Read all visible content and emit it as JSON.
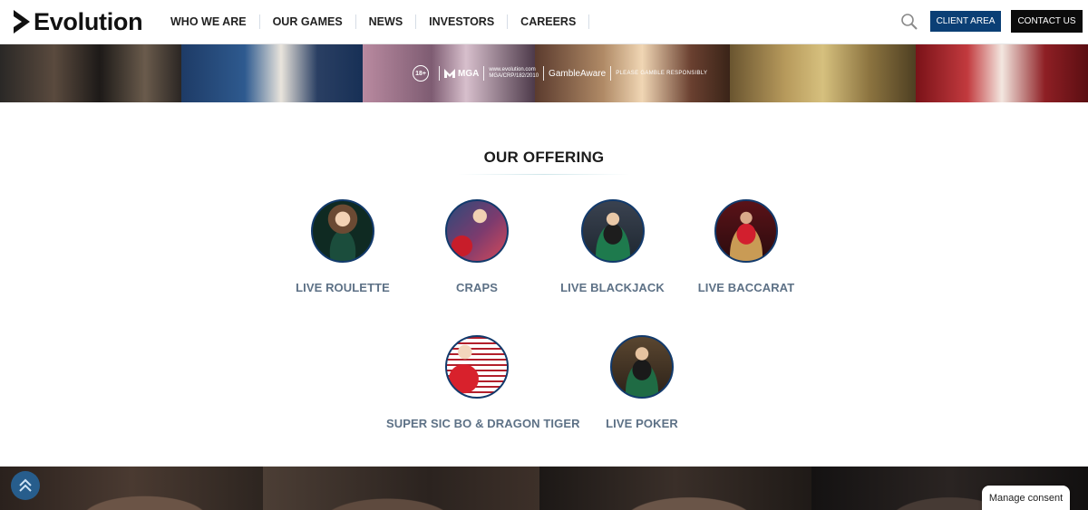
{
  "header": {
    "logo_text": "Evolution",
    "nav": [
      {
        "label": "WHO WE ARE"
      },
      {
        "label": "OUR GAMES"
      },
      {
        "label": "NEWS"
      },
      {
        "label": "INVESTORS"
      },
      {
        "label": "CAREERS"
      }
    ],
    "client_area_label": "CLIENT AREA",
    "contact_label": "CONTACT US"
  },
  "hero": {
    "age_label": "18+",
    "mga_label": "MGA",
    "mga_reg_line1": "www.evolution.com",
    "mga_reg_line2": "MGA/CRP/182/2010",
    "gambleaware_label": "GambleAware",
    "responsible_label": "PLEASE GAMBLE RESPONSIBLY"
  },
  "offering": {
    "title": "OUR OFFERING",
    "games": [
      {
        "label": "LIVE ROULETTE"
      },
      {
        "label": "CRAPS"
      },
      {
        "label": "LIVE BLACKJACK"
      },
      {
        "label": "LIVE BACCARAT"
      },
      {
        "label": "SUPER SIC BO & DRAGON TIGER"
      },
      {
        "label": "LIVE POKER"
      }
    ]
  },
  "consent": {
    "label": "Manage consent"
  },
  "colors": {
    "client_button": "#0b3f75",
    "contact_button": "#0b0b0b",
    "circle_border": "#123a6c",
    "game_label": "#5d7186",
    "scroll_top": "#275d8c"
  },
  "icons": {
    "search": "search-icon",
    "scroll_top": "double-chevron-up-icon"
  }
}
